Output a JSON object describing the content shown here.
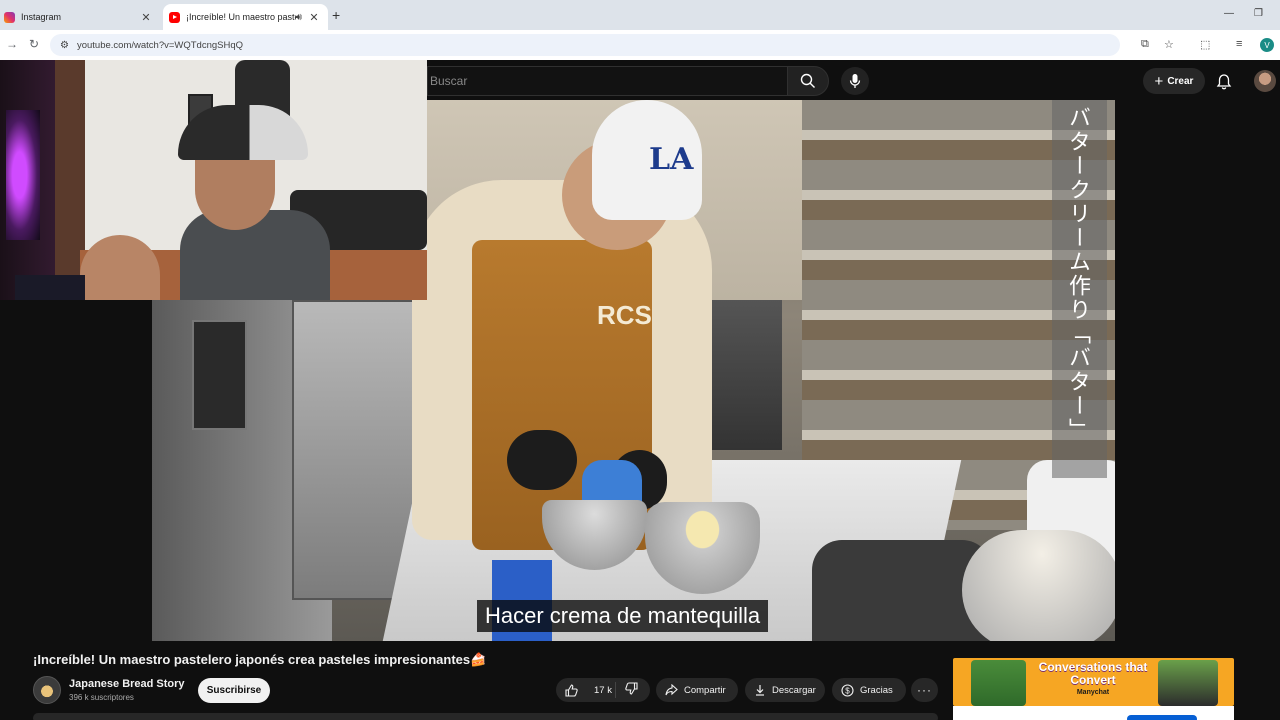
{
  "browser": {
    "tabs": [
      {
        "title": "Instagram",
        "active": false
      },
      {
        "title": "¡Increíble! Un maestro paste",
        "active": true
      }
    ],
    "url": "youtube.com/watch?v=WQTdcngSHqQ",
    "profile_initial": "V"
  },
  "masthead": {
    "search_placeholder": "Buscar",
    "create_label": "Crear"
  },
  "video": {
    "subtitle": "Hacer crema de mantequilla",
    "vertical_caption": "バタークリーム作り「バター」",
    "apron_text": "RCS",
    "cap_text": "LA"
  },
  "info": {
    "title": "¡Increíble! Un maestro pastelero japonés crea pasteles impresionantes🍰",
    "channel_name": "Japanese Bread Story",
    "subscribers": "396 k suscriptores",
    "subscribe_label": "Suscribirse",
    "likes": "17 k",
    "share_label": "Compartir",
    "download_label": "Descargar",
    "thanks_label": "Gracias",
    "more_label": "···"
  },
  "ad": {
    "title": "Conversations that Convert",
    "brand": "Manychat"
  },
  "colors": {
    "youtube_red": "#ff0000",
    "page_bg": "#0f0f0f",
    "ad_bg": "#f6a623",
    "profile": "#1a8c86"
  }
}
